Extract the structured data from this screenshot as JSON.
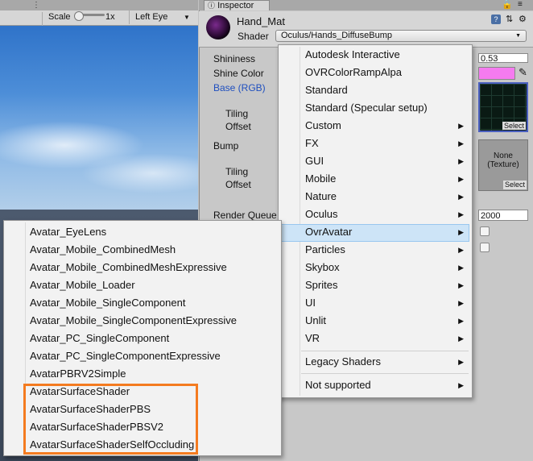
{
  "scene_toolbar": {
    "scale_label": "Scale",
    "scale_value": "1x",
    "display_label": "Left Eye"
  },
  "inspector": {
    "tab_title": "Inspector",
    "material_name": "Hand_Mat",
    "shader_label": "Shader",
    "shader_value": "Oculus/Hands_DiffuseBump",
    "properties": {
      "shininess_label": "Shininess",
      "shininess_value": "0.53",
      "shine_color_label": "Shine Color",
      "shine_color": "#f57bf0",
      "base_label": "Base (RGB)",
      "tiling_label": "Tiling",
      "offset_label": "Offset",
      "bump_label": "Bump",
      "tiling2_label": "Tiling",
      "offset2_label": "Offset",
      "texture_none": "None\n(Texture)",
      "select_label": "Select",
      "select2_label": "Select",
      "render_queue_label": "Render Queue",
      "render_queue_value": "2000"
    }
  },
  "shader_menu": {
    "items": [
      {
        "label": "Autodesk Interactive",
        "submenu": false
      },
      {
        "label": "OVRColorRampAlpa",
        "submenu": false
      },
      {
        "label": "Standard",
        "submenu": false
      },
      {
        "label": "Standard (Specular setup)",
        "submenu": false
      },
      {
        "label": "Custom",
        "submenu": true
      },
      {
        "label": "FX",
        "submenu": true
      },
      {
        "label": "GUI",
        "submenu": true
      },
      {
        "label": "Mobile",
        "submenu": true
      },
      {
        "label": "Nature",
        "submenu": true
      },
      {
        "label": "Oculus",
        "submenu": true
      },
      {
        "label": "OvrAvatar",
        "submenu": true,
        "highlighted": true
      },
      {
        "label": "Particles",
        "submenu": true
      },
      {
        "label": "Skybox",
        "submenu": true
      },
      {
        "label": "Sprites",
        "submenu": true
      },
      {
        "label": "UI",
        "submenu": true
      },
      {
        "label": "Unlit",
        "submenu": true
      },
      {
        "label": "VR",
        "submenu": true
      },
      {
        "label": "Legacy Shaders",
        "submenu": true
      },
      {
        "label": "Not supported",
        "submenu": true
      }
    ]
  },
  "ovravatar_submenu": {
    "items": [
      "Avatar_EyeLens",
      "Avatar_Mobile_CombinedMesh",
      "Avatar_Mobile_CombinedMeshExpressive",
      "Avatar_Mobile_Loader",
      "Avatar_Mobile_SingleComponent",
      "Avatar_Mobile_SingleComponentExpressive",
      "Avatar_PC_SingleComponent",
      "Avatar_PC_SingleComponentExpressive",
      "AvatarPBRV2Simple",
      "AvatarSurfaceShader",
      "AvatarSurfaceShaderPBS",
      "AvatarSurfaceShaderPBSV2",
      "AvatarSurfaceShaderSelfOccluding"
    ],
    "highlight_color": "#f47b20"
  }
}
